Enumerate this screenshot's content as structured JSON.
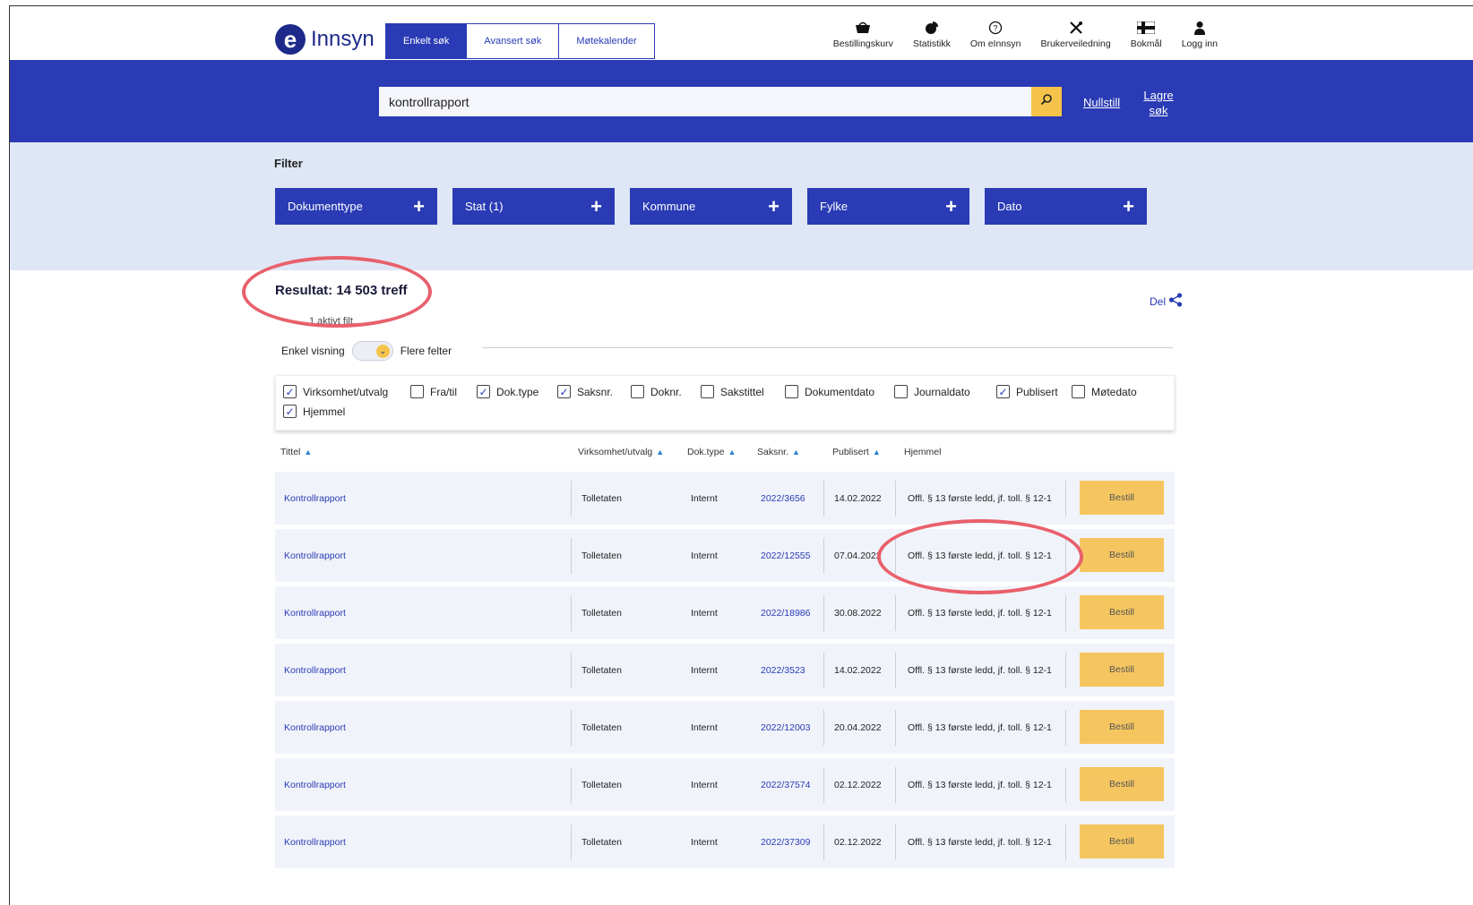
{
  "logo": {
    "letter": "e",
    "text": "Innsyn"
  },
  "tabs": [
    "Enkelt søk",
    "Avansert søk",
    "Møtekalender"
  ],
  "topnav": [
    {
      "label": "Bestillingskurv",
      "icon": "basket-icon"
    },
    {
      "label": "Statistikk",
      "icon": "pie-chart-icon"
    },
    {
      "label": "Om eInnsyn",
      "icon": "help-icon"
    },
    {
      "label": "Brukerveiledning",
      "icon": "tools-icon"
    },
    {
      "label": "Bokmål",
      "icon": "flag-icon"
    },
    {
      "label": "Logg inn",
      "icon": "user-icon"
    }
  ],
  "search": {
    "value": "kontrollrapport",
    "reset_label": "Nullstill",
    "save_label": "Lagre søk"
  },
  "filter": {
    "title": "Filter",
    "buttons": [
      "Dokumenttype",
      "Stat (1)",
      "Kommune",
      "Fylke",
      "Dato"
    ]
  },
  "results": {
    "title": "Resultat: 14 503 treff",
    "active_filter_text": "1 aktivt filt...",
    "share_label": "Del",
    "toggle_left": "Enkel visning",
    "toggle_right": "Flere felter"
  },
  "fields": [
    {
      "label": "Virksomhet/utvalg",
      "checked": true
    },
    {
      "label": "Fra/til",
      "checked": false
    },
    {
      "label": "Dok.type",
      "checked": true
    },
    {
      "label": "Saksnr.",
      "checked": true
    },
    {
      "label": "Doknr.",
      "checked": false
    },
    {
      "label": "Sakstittel",
      "checked": false
    },
    {
      "label": "Dokumentdato",
      "checked": false
    },
    {
      "label": "Journaldato",
      "checked": false
    },
    {
      "label": "Publisert",
      "checked": true
    },
    {
      "label": "Møtedato",
      "checked": false
    },
    {
      "label": "Hjemmel",
      "checked": true
    }
  ],
  "columns": [
    "Tittel",
    "Virksomhet/utvalg",
    "Dok.type",
    "Saksnr.",
    "Publisert",
    "Hjemmel"
  ],
  "order_label": "Bestill",
  "rows": [
    {
      "title": "Kontrollrapport",
      "org": "Tolletaten",
      "doctype": "Internt",
      "caseno": "2022/3656",
      "published": "14.02.2022",
      "legal": "Offl. § 13 første ledd, jf. toll. § 12-1"
    },
    {
      "title": "Kontrollrapport",
      "org": "Tolletaten",
      "doctype": "Internt",
      "caseno": "2022/12555",
      "published": "07.04.2022",
      "legal": "Offl. § 13 første ledd, jf. toll. § 12-1"
    },
    {
      "title": "Kontrollrapport",
      "org": "Tolletaten",
      "doctype": "Internt",
      "caseno": "2022/18986",
      "published": "30.08.2022",
      "legal": "Offl. § 13 første ledd, jf. toll. § 12-1"
    },
    {
      "title": "Kontrollrapport",
      "org": "Tolletaten",
      "doctype": "Internt",
      "caseno": "2022/3523",
      "published": "14.02.2022",
      "legal": "Offl. § 13 første ledd, jf. toll. § 12-1"
    },
    {
      "title": "Kontrollrapport",
      "org": "Tolletaten",
      "doctype": "Internt",
      "caseno": "2022/12003",
      "published": "20.04.2022",
      "legal": "Offl. § 13 første ledd, jf. toll. § 12-1"
    },
    {
      "title": "Kontrollrapport",
      "org": "Tolletaten",
      "doctype": "Internt",
      "caseno": "2022/37574",
      "published": "02.12.2022",
      "legal": "Offl. § 13 første ledd, jf. toll. § 12-1"
    },
    {
      "title": "Kontrollrapport",
      "org": "Tolletaten",
      "doctype": "Internt",
      "caseno": "2022/37309",
      "published": "02.12.2022",
      "legal": "Offl. § 13 første ledd, jf. toll. § 12-1"
    }
  ],
  "colors": {
    "brand": "#2a3bb5",
    "accent": "#f5c34a",
    "filter_bg": "#dfe7f6",
    "highlight": "#e8606b"
  }
}
